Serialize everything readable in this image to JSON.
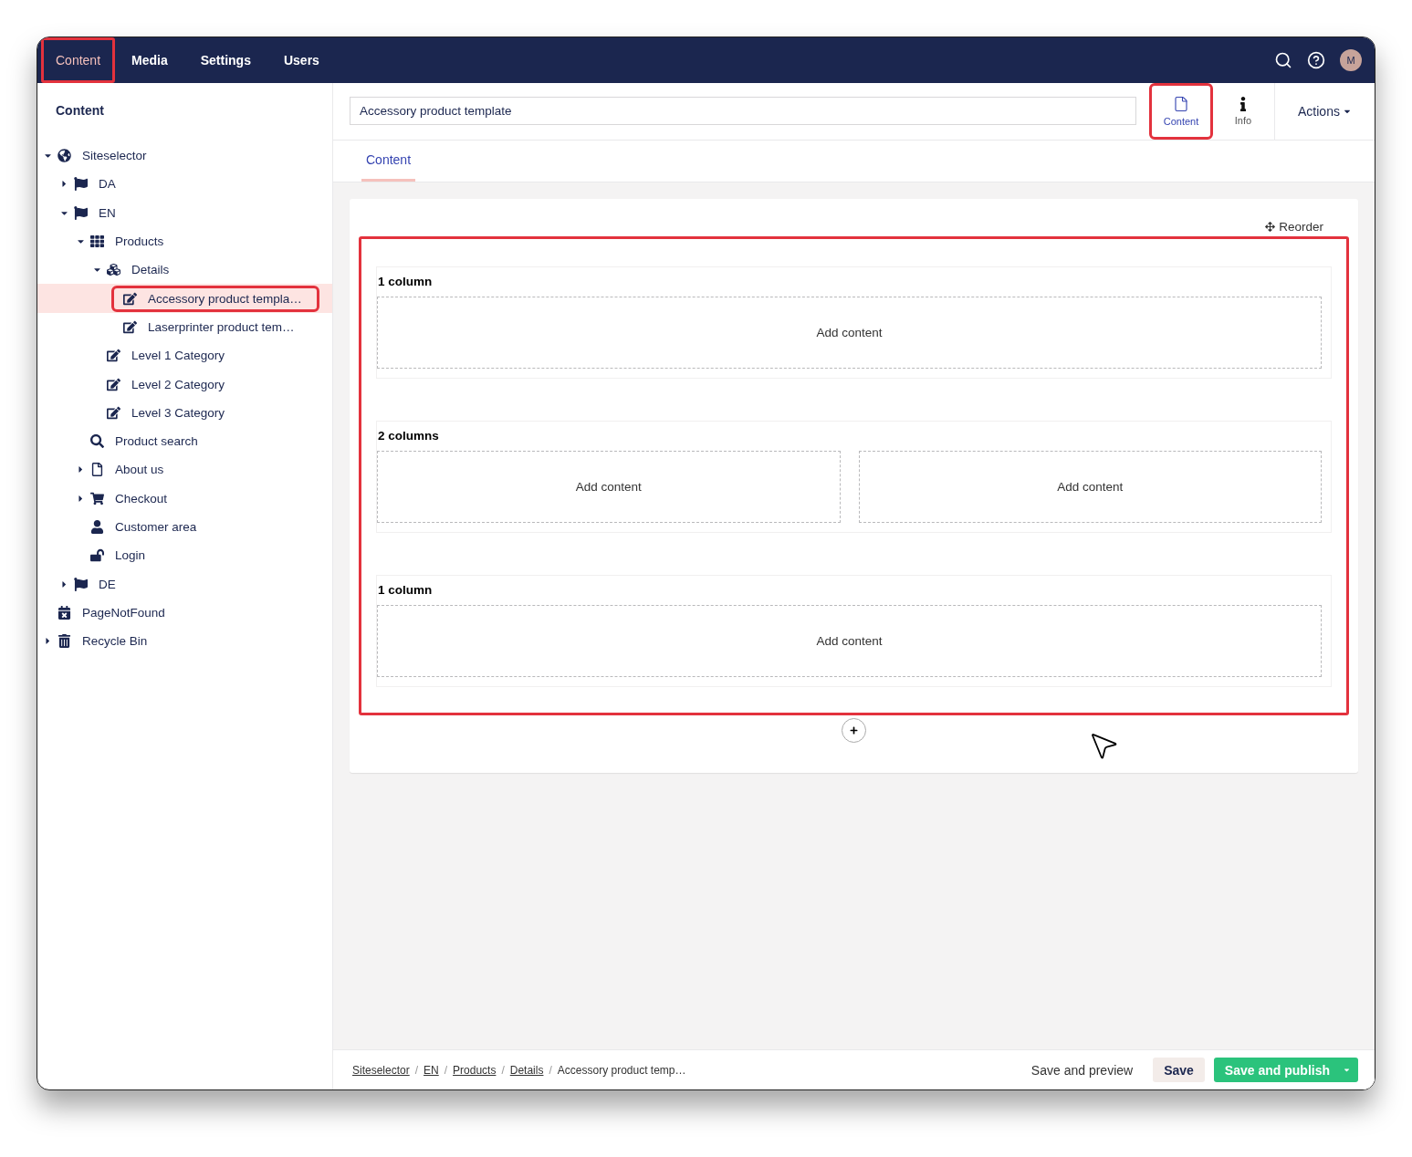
{
  "top_nav": {
    "items": [
      {
        "label": "Content",
        "selected": true,
        "highlighted": true
      },
      {
        "label": "Media",
        "selected": false,
        "highlighted": false
      },
      {
        "label": "Settings",
        "selected": false,
        "highlighted": false
      },
      {
        "label": "Users",
        "selected": false,
        "highlighted": false
      }
    ],
    "avatar": "M"
  },
  "sidebar": {
    "title": "Content",
    "tree": [
      {
        "label": "Siteselector",
        "kind": "globe",
        "expanded": true,
        "selected": false,
        "highlighted": false,
        "children": [
          {
            "label": "DA",
            "kind": "flag",
            "expanded": false,
            "selected": false,
            "highlighted": false
          },
          {
            "label": "EN",
            "kind": "flag",
            "expanded": true,
            "selected": false,
            "highlighted": false,
            "children": [
              {
                "label": "Products",
                "kind": "grid",
                "expanded": true,
                "selected": false,
                "highlighted": false,
                "children": [
                  {
                    "label": "Details",
                    "kind": "cubes",
                    "expanded": true,
                    "selected": false,
                    "highlighted": false,
                    "children": [
                      {
                        "label": "Accessory product templa…",
                        "kind": "edit",
                        "selected": true,
                        "highlighted": true
                      },
                      {
                        "label": "Laserprinter product tem…",
                        "kind": "edit",
                        "selected": false,
                        "highlighted": false
                      }
                    ]
                  },
                  {
                    "label": "Level 1 Category",
                    "kind": "edit",
                    "selected": false,
                    "highlighted": false
                  },
                  {
                    "label": "Level 2 Category",
                    "kind": "edit",
                    "selected": false,
                    "highlighted": false
                  },
                  {
                    "label": "Level 3 Category",
                    "kind": "edit",
                    "selected": false,
                    "highlighted": false
                  }
                ]
              },
              {
                "label": "Product search",
                "kind": "search",
                "selected": false,
                "highlighted": false
              },
              {
                "label": "About us",
                "kind": "file",
                "expanded": false,
                "selected": false,
                "highlighted": false
              },
              {
                "label": "Checkout",
                "kind": "cart",
                "expanded": false,
                "selected": false,
                "highlighted": false
              },
              {
                "label": "Customer area",
                "kind": "user",
                "selected": false,
                "highlighted": false
              },
              {
                "label": "Login",
                "kind": "unlock",
                "selected": false,
                "highlighted": false
              }
            ]
          },
          {
            "label": "DE",
            "kind": "flag",
            "expanded": false,
            "selected": false,
            "highlighted": false
          }
        ]
      },
      {
        "label": "PageNotFound",
        "kind": "calendar",
        "selected": false,
        "highlighted": false
      },
      {
        "label": "Recycle Bin",
        "kind": "trash",
        "expanded": false,
        "selected": false,
        "highlighted": false
      }
    ]
  },
  "editor": {
    "name_value": "Accessory product template",
    "apps": [
      {
        "kind": "document",
        "label": "Content",
        "selected": true,
        "highlighted": true
      },
      {
        "kind": "info",
        "label": "Info",
        "selected": false,
        "highlighted": false
      }
    ],
    "actions": "Actions",
    "tabs": [
      {
        "label": "Content",
        "selected": true
      }
    ],
    "reorder": "Reorder",
    "grid_highlighted": true,
    "rows": [
      {
        "title": "1 column",
        "cells": [
          "Add content"
        ]
      },
      {
        "title": "2 columns",
        "cells": [
          "Add content",
          "Add content"
        ]
      },
      {
        "title": "1 column",
        "cells": [
          "Add content"
        ]
      }
    ]
  },
  "footer": {
    "separator": "/",
    "breadcrumbs": [
      {
        "label": "Siteselector",
        "link": true
      },
      {
        "label": "EN",
        "link": true
      },
      {
        "label": "Products",
        "link": true
      },
      {
        "label": "Details",
        "link": true
      },
      {
        "label": "Accessory product temp…",
        "link": false
      }
    ],
    "buttons": [
      {
        "kind": "text",
        "label": "Save and preview"
      },
      {
        "kind": "secondary",
        "label": "Save"
      },
      {
        "kind": "primary",
        "label": "Save and publish"
      }
    ]
  }
}
